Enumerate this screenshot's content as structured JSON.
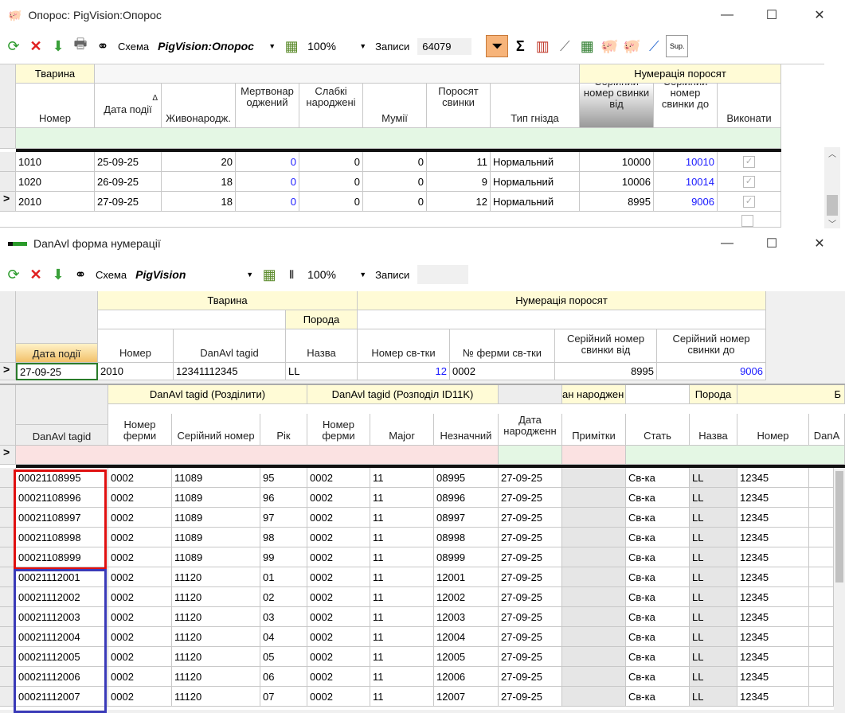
{
  "win1": {
    "title": "Опорос: PigVision:Опорос",
    "toolbar": {
      "schema_label": "Схема",
      "schema_value": "PigVision:Опорос",
      "zoom": "100%",
      "records_label": "Записи",
      "records_value": "64079",
      "sup_label": "Sup."
    },
    "groups": {
      "animal": "Тварина",
      "numbering": "Нумерація поросят"
    },
    "columns": [
      "Номер",
      "Дата події",
      "Живонародж.",
      "Мертвонар оджений",
      "Слабкі народжені",
      "Мумії",
      "Поросят свинки",
      "Тип гнізда",
      "Серійний номер свинки від",
      "Серійний номер свинки до",
      "Виконати"
    ],
    "sort_indicator": "Δ",
    "rows": [
      {
        "nomer": "1010",
        "date": "25-09-25",
        "zhyvo": "20",
        "mertvo": "0",
        "slabki": "0",
        "mumii": "0",
        "porosyat": "11",
        "typ": "Нормальний",
        "from": "10000",
        "to": "10010"
      },
      {
        "nomer": "1020",
        "date": "26-09-25",
        "zhyvo": "18",
        "mertvo": "0",
        "slabki": "0",
        "mumii": "0",
        "porosyat": "9",
        "typ": "Нормальний",
        "from": "10006",
        "to": "10014"
      },
      {
        "nomer": "2010",
        "date": "27-09-25",
        "zhyvo": "18",
        "mertvo": "0",
        "slabki": "0",
        "mumii": "0",
        "porosyat": "12",
        "typ": "Нормальний",
        "from": "8995",
        "to": "9006"
      }
    ],
    "current_row_marker": ">"
  },
  "win2": {
    "title": "DanAvl форма нумерації",
    "toolbar": {
      "schema_label": "Схема",
      "schema_value": "PigVision",
      "zoom": "100%",
      "records_label": "Записи"
    },
    "master": {
      "groups": {
        "animal": "Тварина",
        "breed": "Порода",
        "numbering": "Нумерація поросят"
      },
      "columns": [
        "Дата події",
        "Номер",
        "DanAvl tagid",
        "Назва",
        "Номер св-тки",
        "№ ферми св-тки",
        "Серійний номер свинки від",
        "Серійний номер свинки до"
      ],
      "row": {
        "date": "27-09-25",
        "nomer": "2010",
        "tagid": "12341112345",
        "nazva": "LL",
        "sow_no": "12",
        "farm": "0002",
        "from": "8995",
        "to": "9006"
      }
    },
    "detail": {
      "groups": {
        "split": "DanAvl tagid (Розділити)",
        "split_id": "DanAvl tagid (Розподіл ID11K)",
        "born": "ан народжен",
        "breed": "Порода",
        "last": "Б"
      },
      "columns": [
        "DanAvl tagid",
        "Номер ферми",
        "Серійний номер",
        "Рік",
        "Номер ферми",
        "Major",
        "Незначний",
        "Дата народженн",
        "Примітки",
        "Стать",
        "Назва",
        "Номер",
        "DanA"
      ],
      "rows": [
        {
          "tag": "00021108995",
          "farm": "0002",
          "serial": "11089",
          "year": "95",
          "farm2": "0002",
          "major": "11",
          "minor": "08995",
          "born": "27-09-25",
          "sex": "Св-ка",
          "breed": "LL",
          "num": "12345"
        },
        {
          "tag": "00021108996",
          "farm": "0002",
          "serial": "11089",
          "year": "96",
          "farm2": "0002",
          "major": "11",
          "minor": "08996",
          "born": "27-09-25",
          "sex": "Св-ка",
          "breed": "LL",
          "num": "12345"
        },
        {
          "tag": "00021108997",
          "farm": "0002",
          "serial": "11089",
          "year": "97",
          "farm2": "0002",
          "major": "11",
          "minor": "08997",
          "born": "27-09-25",
          "sex": "Св-ка",
          "breed": "LL",
          "num": "12345"
        },
        {
          "tag": "00021108998",
          "farm": "0002",
          "serial": "11089",
          "year": "98",
          "farm2": "0002",
          "major": "11",
          "minor": "08998",
          "born": "27-09-25",
          "sex": "Св-ка",
          "breed": "LL",
          "num": "12345"
        },
        {
          "tag": "00021108999",
          "farm": "0002",
          "serial": "11089",
          "year": "99",
          "farm2": "0002",
          "major": "11",
          "minor": "08999",
          "born": "27-09-25",
          "sex": "Св-ка",
          "breed": "LL",
          "num": "12345"
        },
        {
          "tag": "00021112001",
          "farm": "0002",
          "serial": "11120",
          "year": "01",
          "farm2": "0002",
          "major": "11",
          "minor": "12001",
          "born": "27-09-25",
          "sex": "Св-ка",
          "breed": "LL",
          "num": "12345"
        },
        {
          "tag": "00021112002",
          "farm": "0002",
          "serial": "11120",
          "year": "02",
          "farm2": "0002",
          "major": "11",
          "minor": "12002",
          "born": "27-09-25",
          "sex": "Св-ка",
          "breed": "LL",
          "num": "12345"
        },
        {
          "tag": "00021112003",
          "farm": "0002",
          "serial": "11120",
          "year": "03",
          "farm2": "0002",
          "major": "11",
          "minor": "12003",
          "born": "27-09-25",
          "sex": "Св-ка",
          "breed": "LL",
          "num": "12345"
        },
        {
          "tag": "00021112004",
          "farm": "0002",
          "serial": "11120",
          "year": "04",
          "farm2": "0002",
          "major": "11",
          "minor": "12004",
          "born": "27-09-25",
          "sex": "Св-ка",
          "breed": "LL",
          "num": "12345"
        },
        {
          "tag": "00021112005",
          "farm": "0002",
          "serial": "11120",
          "year": "05",
          "farm2": "0002",
          "major": "11",
          "minor": "12005",
          "born": "27-09-25",
          "sex": "Св-ка",
          "breed": "LL",
          "num": "12345"
        },
        {
          "tag": "00021112006",
          "farm": "0002",
          "serial": "11120",
          "year": "06",
          "farm2": "0002",
          "major": "11",
          "minor": "12006",
          "born": "27-09-25",
          "sex": "Св-ка",
          "breed": "LL",
          "num": "12345"
        },
        {
          "tag": "00021112007",
          "farm": "0002",
          "serial": "11120",
          "year": "07",
          "farm2": "0002",
          "major": "11",
          "minor": "12007",
          "born": "27-09-25",
          "sex": "Св-ка",
          "breed": "LL",
          "num": "12345"
        }
      ]
    }
  },
  "colors": {
    "group_header": "#fffbd6",
    "filter_row": "#e4f7e4",
    "filter_row_pink": "#fbe2e2",
    "link_blue": "#1a1aff",
    "highlight_red": "#e01010",
    "highlight_blue": "#3a3ab8"
  }
}
